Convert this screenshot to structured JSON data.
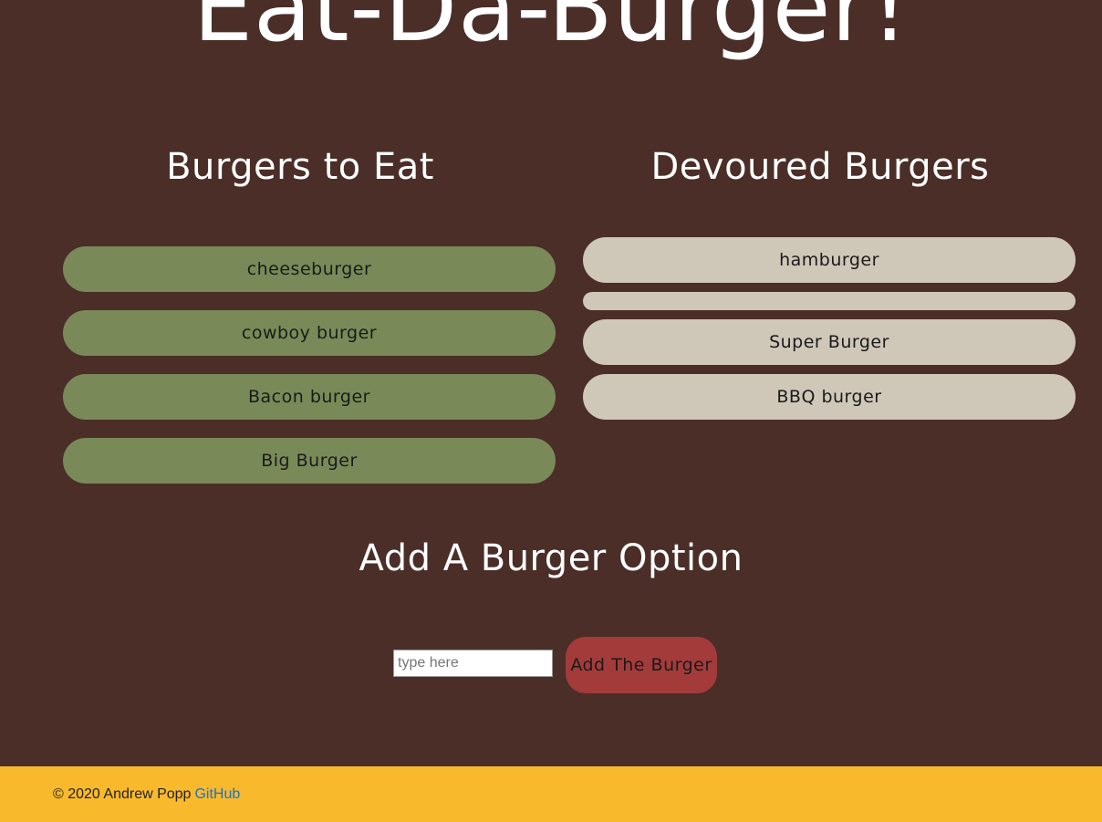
{
  "header": {
    "title": "Eat-Da-Burger!"
  },
  "to_eat": {
    "title": "Burgers to Eat",
    "items": [
      "cheeseburger",
      "cowboy burger",
      "Bacon burger",
      "Big Burger"
    ]
  },
  "devoured": {
    "title": "Devoured Burgers",
    "items": [
      "hamburger",
      "",
      "Super Burger",
      "BBQ burger"
    ]
  },
  "add_form": {
    "title": "Add A Burger Option",
    "input_placeholder": "type here",
    "input_value": "",
    "button_label": "Add The Burger"
  },
  "footer": {
    "copyright": "© 2020 Andrew Popp",
    "link_label": "GitHub"
  },
  "colors": {
    "background": "#4a2e27",
    "to_eat_pill": "#798a58",
    "devoured_pill": "#cfc7b8",
    "add_button": "#a33b3b",
    "footer": "#f8b92c",
    "link": "#1a73c8"
  }
}
